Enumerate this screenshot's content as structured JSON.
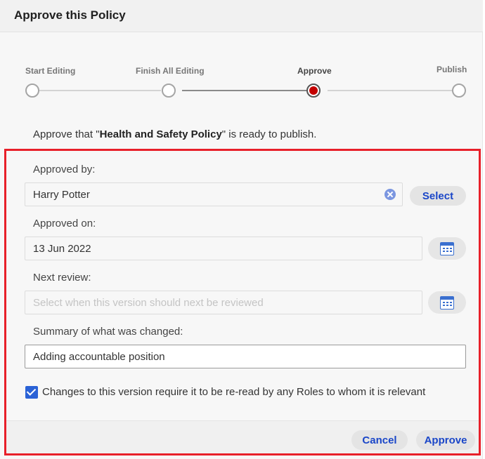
{
  "dialog": {
    "title": "Approve this Policy"
  },
  "stepper": {
    "steps": [
      {
        "label": "Start Editing",
        "state": "done"
      },
      {
        "label": "Finish All Editing",
        "state": "done"
      },
      {
        "label": "Approve",
        "state": "current"
      },
      {
        "label": "Publish",
        "state": "upcoming"
      }
    ]
  },
  "intro": {
    "prefix": "Approve that \"",
    "policy_name": "Health and Safety Policy",
    "suffix": "\" is ready to publish."
  },
  "approved_by": {
    "label": "Approved by:",
    "value": "Harry Potter",
    "select_label": "Select"
  },
  "approved_on": {
    "label": "Approved on:",
    "value": "13 Jun 2022"
  },
  "next_review": {
    "label": "Next review:",
    "placeholder": "Select when this version should next be reviewed"
  },
  "summary": {
    "label": "Summary of what was changed:",
    "value": "Adding accountable position"
  },
  "reread": {
    "label": "Changes to this version require it to be re-read by any Roles to whom it is relevant",
    "checked": true
  },
  "footer": {
    "cancel_label": "Cancel",
    "approve_label": "Approve"
  },
  "colors": {
    "accent": "#1a46c8",
    "current_step": "#c30000",
    "highlight_border": "#e8202a",
    "checkbox": "#2a62d6"
  },
  "icons": {
    "clear": "clear-icon",
    "calendar": "calendar-icon",
    "check": "check-icon"
  }
}
